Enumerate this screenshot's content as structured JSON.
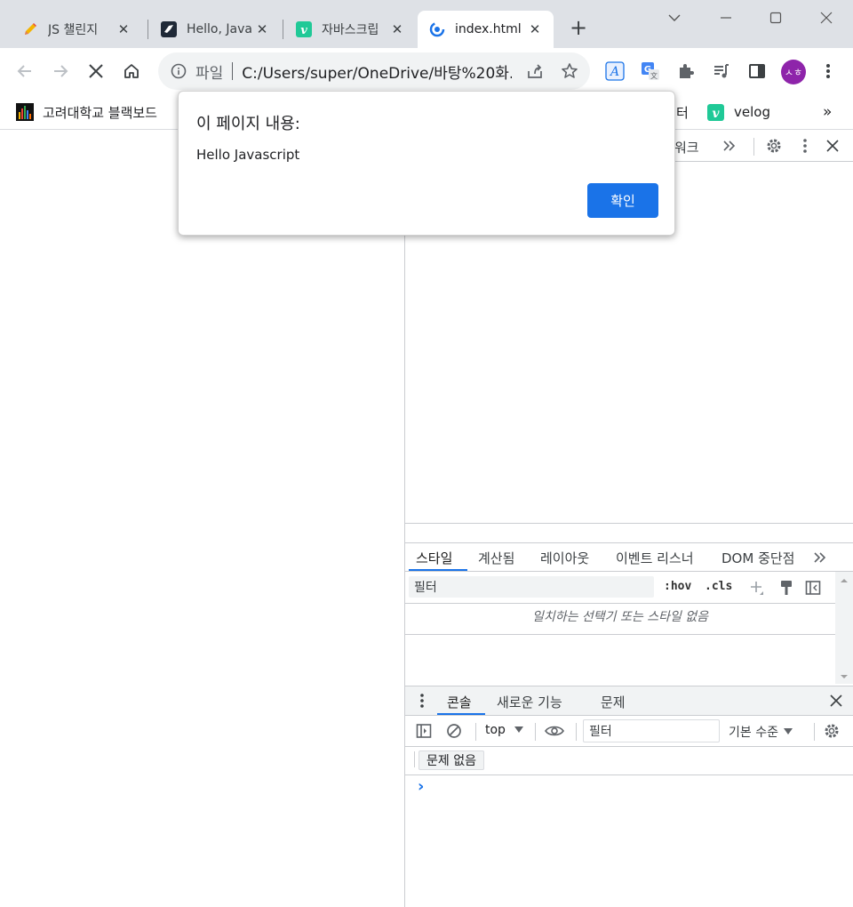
{
  "tabs": [
    {
      "label": "JS 챌린지",
      "icon": "pencil-icon",
      "close": "✕"
    },
    {
      "label": "Hello, Java",
      "icon": "bird-icon",
      "close": "✕"
    },
    {
      "label": "자바스크립",
      "icon": "velog-icon",
      "close": "✕"
    },
    {
      "label": "index.html",
      "icon": "loading-icon",
      "close": "✕"
    }
  ],
  "address": {
    "scheme": "파일",
    "url": "C:/Users/super/OneDrive/바탕%20화..."
  },
  "bookmarks": [
    {
      "label": "고려대학교 블랙보드",
      "icon": "blackboard-icon"
    },
    {
      "label": "터",
      "icon": ""
    },
    {
      "label": "velog",
      "icon": "velog-icon"
    }
  ],
  "bookmarks_more": "»",
  "dialog": {
    "title": "이 페이지 내용:",
    "message": "Hello Javascript",
    "ok_label": "확인"
  },
  "devtools": {
    "top_tab_partial": "워크",
    "profile_initials": "ㅅㅎ",
    "style_tabs": [
      "스타일",
      "계산됨",
      "레이아웃",
      "이벤트 리스너",
      "DOM 중단점"
    ],
    "filter_placeholder": "필터",
    "hov": ":hov",
    "cls": ".cls",
    "no_styles": "일치하는 선택기 또는 스타일 없음",
    "drawer_tabs": [
      "콘솔",
      "새로운 기능",
      "문제"
    ],
    "context": "top",
    "console_filter_placeholder": "필터",
    "levels": "기본 수준",
    "issues_button": "문제 없음",
    "prompt": "›"
  },
  "colors": {
    "accent": "#1a73e8",
    "tabstrip": "#dee1e6",
    "avatar": "#8e24aa",
    "velog": "#20c997"
  }
}
